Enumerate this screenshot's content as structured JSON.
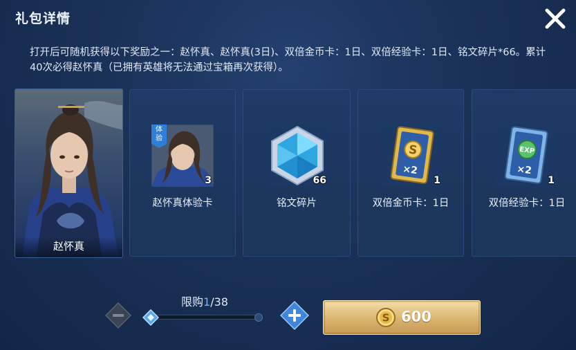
{
  "dialog": {
    "title": "礼包详情",
    "description": "打开后可随机获得以下奖励之一：赵怀真、赵怀真(3日)、双倍金币卡：1日、双倍经验卡：1日、铭文碎片*66。累计40次必得赵怀真（已拥有英雄将无法通过宝箱再次获得）。"
  },
  "rewards": {
    "hero": {
      "name": "赵怀真"
    },
    "items": [
      {
        "label": "赵怀真体验卡",
        "qty": "3",
        "badge": "体验",
        "icon": "hero-trial-card-icon"
      },
      {
        "label": "铭文碎片",
        "qty": "66",
        "icon": "inscription-shard-icon"
      },
      {
        "label": "双倍金币卡：1日",
        "qty": "1",
        "icon": "double-gold-card-icon"
      },
      {
        "label": "双倍经验卡：1日",
        "qty": "1",
        "icon": "double-exp-card-icon"
      }
    ]
  },
  "purchase": {
    "limit_label": "限购",
    "current": "1",
    "max": "/38",
    "price": "600",
    "current_fraction": 0.0
  },
  "colors": {
    "accent_blue": "#6fb0ff",
    "gold_button": "#dcb773",
    "panel_bg": "#1a3158"
  }
}
